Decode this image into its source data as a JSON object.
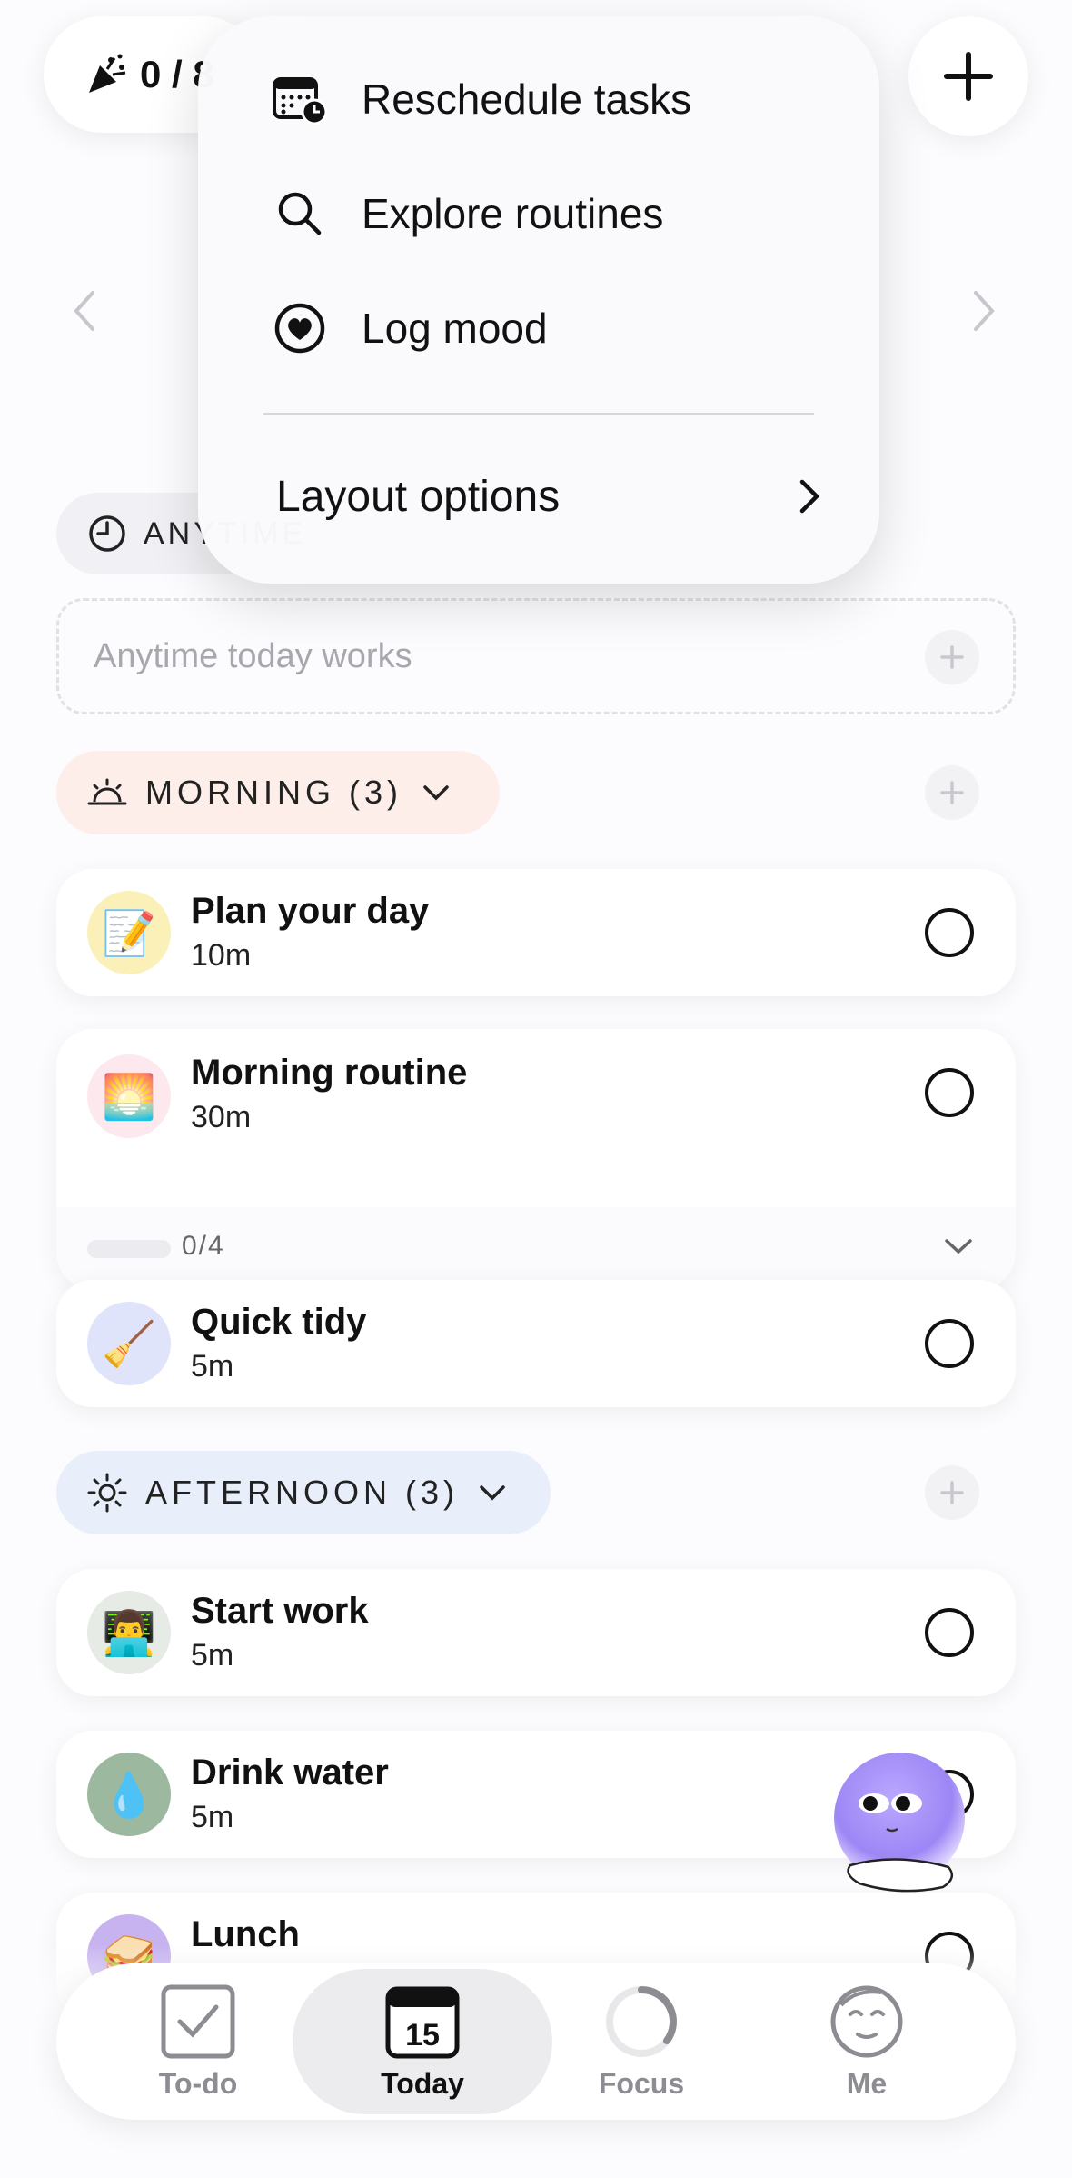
{
  "header": {
    "progress_text": "0 / 8",
    "add_button_icon": "plus-icon"
  },
  "menu": {
    "items": [
      {
        "label": "Reschedule tasks",
        "icon": "calendar-clock-icon"
      },
      {
        "label": "Explore routines",
        "icon": "search-icon"
      },
      {
        "label": "Log mood",
        "icon": "heart-circle-icon"
      }
    ],
    "layout_label": "Layout options"
  },
  "anytime": {
    "header_label": "ANYTIME",
    "placeholder": "Anytime today works"
  },
  "sections": {
    "morning": {
      "label": "MORNING (3)",
      "color": "#fdeee9",
      "tasks": [
        {
          "title": "Plan your day",
          "duration": "10m",
          "emoji": "📝",
          "bg": "#fbf0b8"
        },
        {
          "title": "Morning routine",
          "duration": "30m",
          "emoji": "🌅",
          "bg": "#fde8ee",
          "subtask_progress": "0/4"
        },
        {
          "title": "Quick tidy",
          "duration": "5m",
          "emoji": "🧹",
          "bg": "#dfe4fb"
        }
      ]
    },
    "afternoon": {
      "label": "AFTERNOON (3)",
      "color": "#e9eefb",
      "tasks": [
        {
          "title": "Start work",
          "duration": "5m",
          "emoji": "👨‍💻",
          "bg": "#e6ebe6"
        },
        {
          "title": "Drink water",
          "duration": "5m",
          "emoji": "💧",
          "bg": "#9cb89e"
        },
        {
          "title": "Lunch",
          "duration": "",
          "emoji": "🥪",
          "bg": "#c7b3f0"
        }
      ]
    }
  },
  "nav": {
    "items": [
      {
        "label": "To-do",
        "icon": "checkbox-icon"
      },
      {
        "label": "Today",
        "icon": "calendar-icon",
        "day": "15"
      },
      {
        "label": "Focus",
        "icon": "focus-ring-icon"
      },
      {
        "label": "Me",
        "icon": "face-icon"
      }
    ]
  }
}
